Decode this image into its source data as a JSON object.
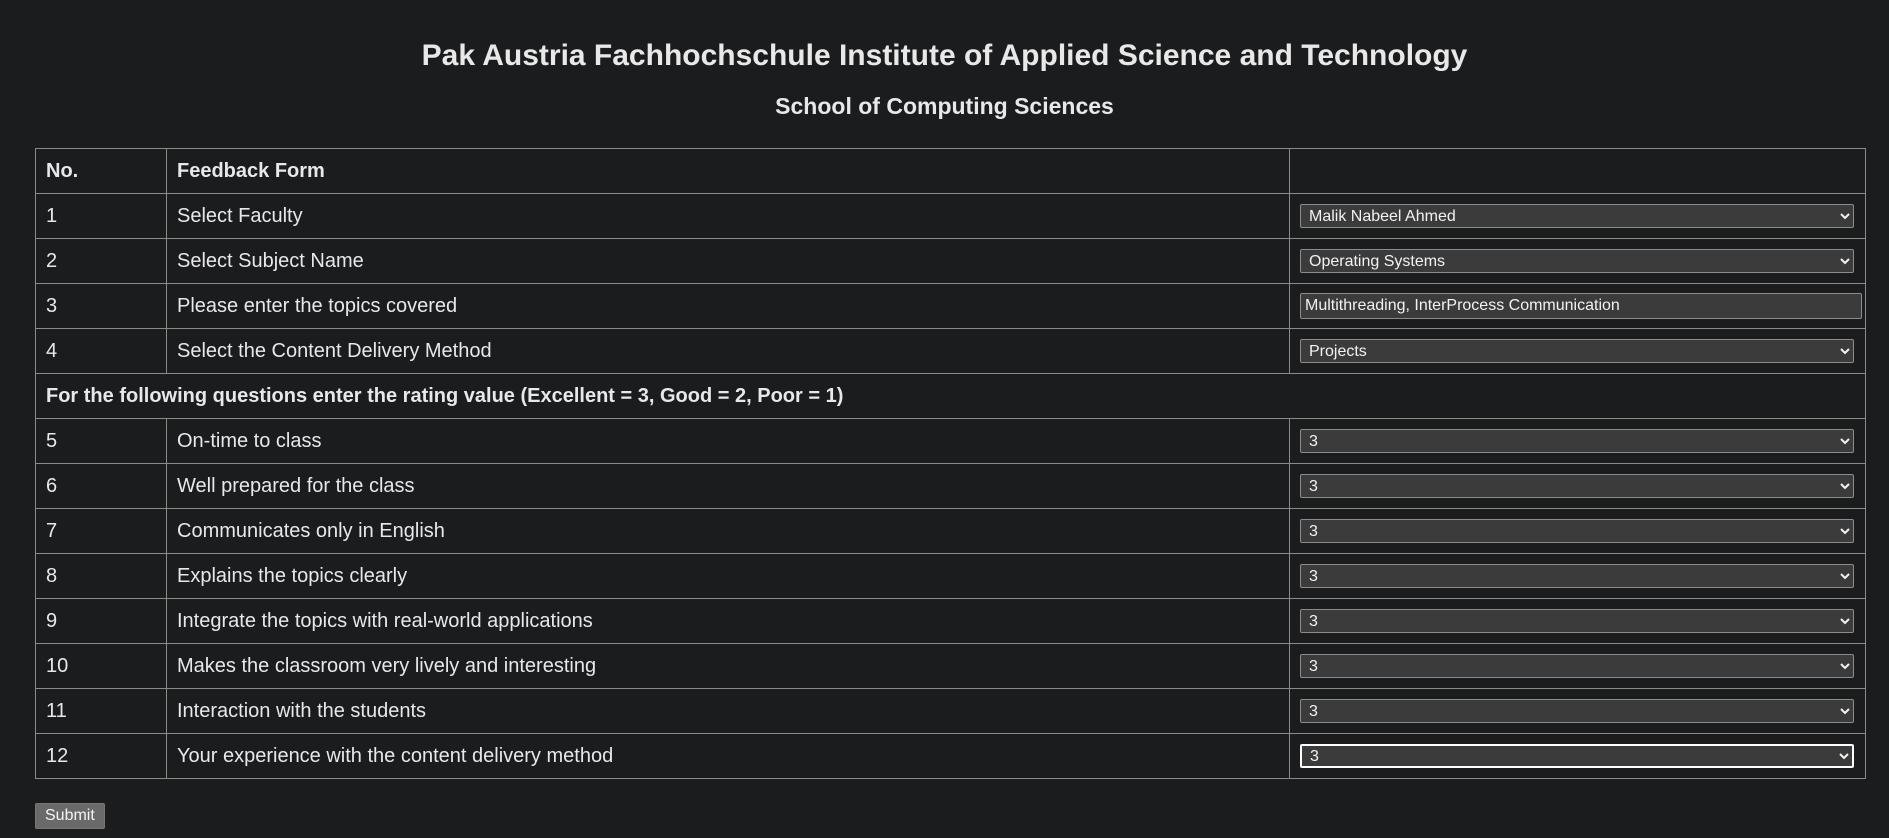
{
  "header": {
    "title": "Pak Austria Fachhochschule Institute of Applied Science and Technology",
    "subtitle": "School of Computing Sciences"
  },
  "table": {
    "header_no": "No.",
    "header_form": "Feedback Form",
    "rows": [
      {
        "no": "1",
        "label": "Select Faculty",
        "value": "Malik Nabeel Ahmed"
      },
      {
        "no": "2",
        "label": "Select Subject Name",
        "value": "Operating Systems"
      },
      {
        "no": "3",
        "label": "Please enter the topics covered",
        "value": "Multithreading, InterProcess Communication"
      },
      {
        "no": "4",
        "label": "Select the Content Delivery Method",
        "value": "Projects"
      }
    ],
    "rating_note": "For the following questions enter the rating value (Excellent = 3, Good = 2, Poor = 1)",
    "rating_rows": [
      {
        "no": "5",
        "label": "On-time to class",
        "value": "3"
      },
      {
        "no": "6",
        "label": "Well prepared for the class",
        "value": "3"
      },
      {
        "no": "7",
        "label": "Communicates only in English",
        "value": "3"
      },
      {
        "no": "8",
        "label": "Explains the topics clearly",
        "value": "3"
      },
      {
        "no": "9",
        "label": "Integrate the topics with real-world applications",
        "value": "3"
      },
      {
        "no": "10",
        "label": "Makes the classroom very lively and interesting",
        "value": "3"
      },
      {
        "no": "11",
        "label": "Interaction with the students",
        "value": "3"
      },
      {
        "no": "12",
        "label": "Your experience with the content delivery method",
        "value": "3"
      }
    ]
  },
  "submit_label": "Submit"
}
